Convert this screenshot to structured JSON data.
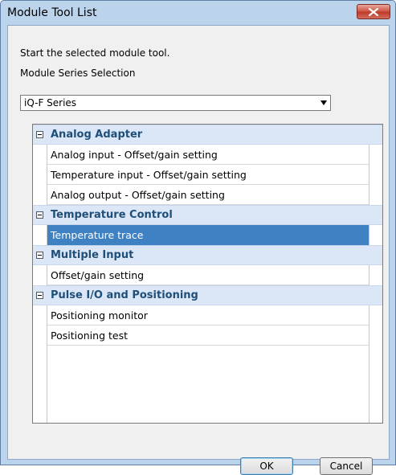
{
  "window": {
    "title": "Module Tool List",
    "close_icon": "close-icon"
  },
  "description": "Start the selected module tool.",
  "series_label": "Module Series Selection",
  "series_select": {
    "value": "iQ-F Series"
  },
  "tree": {
    "categories": [
      {
        "label": "Analog Adapter",
        "items": [
          {
            "label": "Analog input - Offset/gain setting",
            "selected": false
          },
          {
            "label": "Temperature input - Offset/gain setting",
            "selected": false
          },
          {
            "label": "Analog output - Offset/gain setting",
            "selected": false
          }
        ]
      },
      {
        "label": "Temperature Control",
        "items": [
          {
            "label": "Temperature trace",
            "selected": true
          }
        ]
      },
      {
        "label": "Multiple Input",
        "items": [
          {
            "label": "Offset/gain setting",
            "selected": false
          }
        ]
      },
      {
        "label": "Pulse I/O and Positioning",
        "items": [
          {
            "label": "Positioning monitor",
            "selected": false
          },
          {
            "label": "Positioning test",
            "selected": false
          }
        ]
      }
    ]
  },
  "buttons": {
    "ok": "OK",
    "cancel": "Cancel"
  },
  "colors": {
    "selection": "#3e82c4",
    "category_bg": "#dbe7f6",
    "category_text": "#1f4e79",
    "frame": "#bcd3ec"
  }
}
